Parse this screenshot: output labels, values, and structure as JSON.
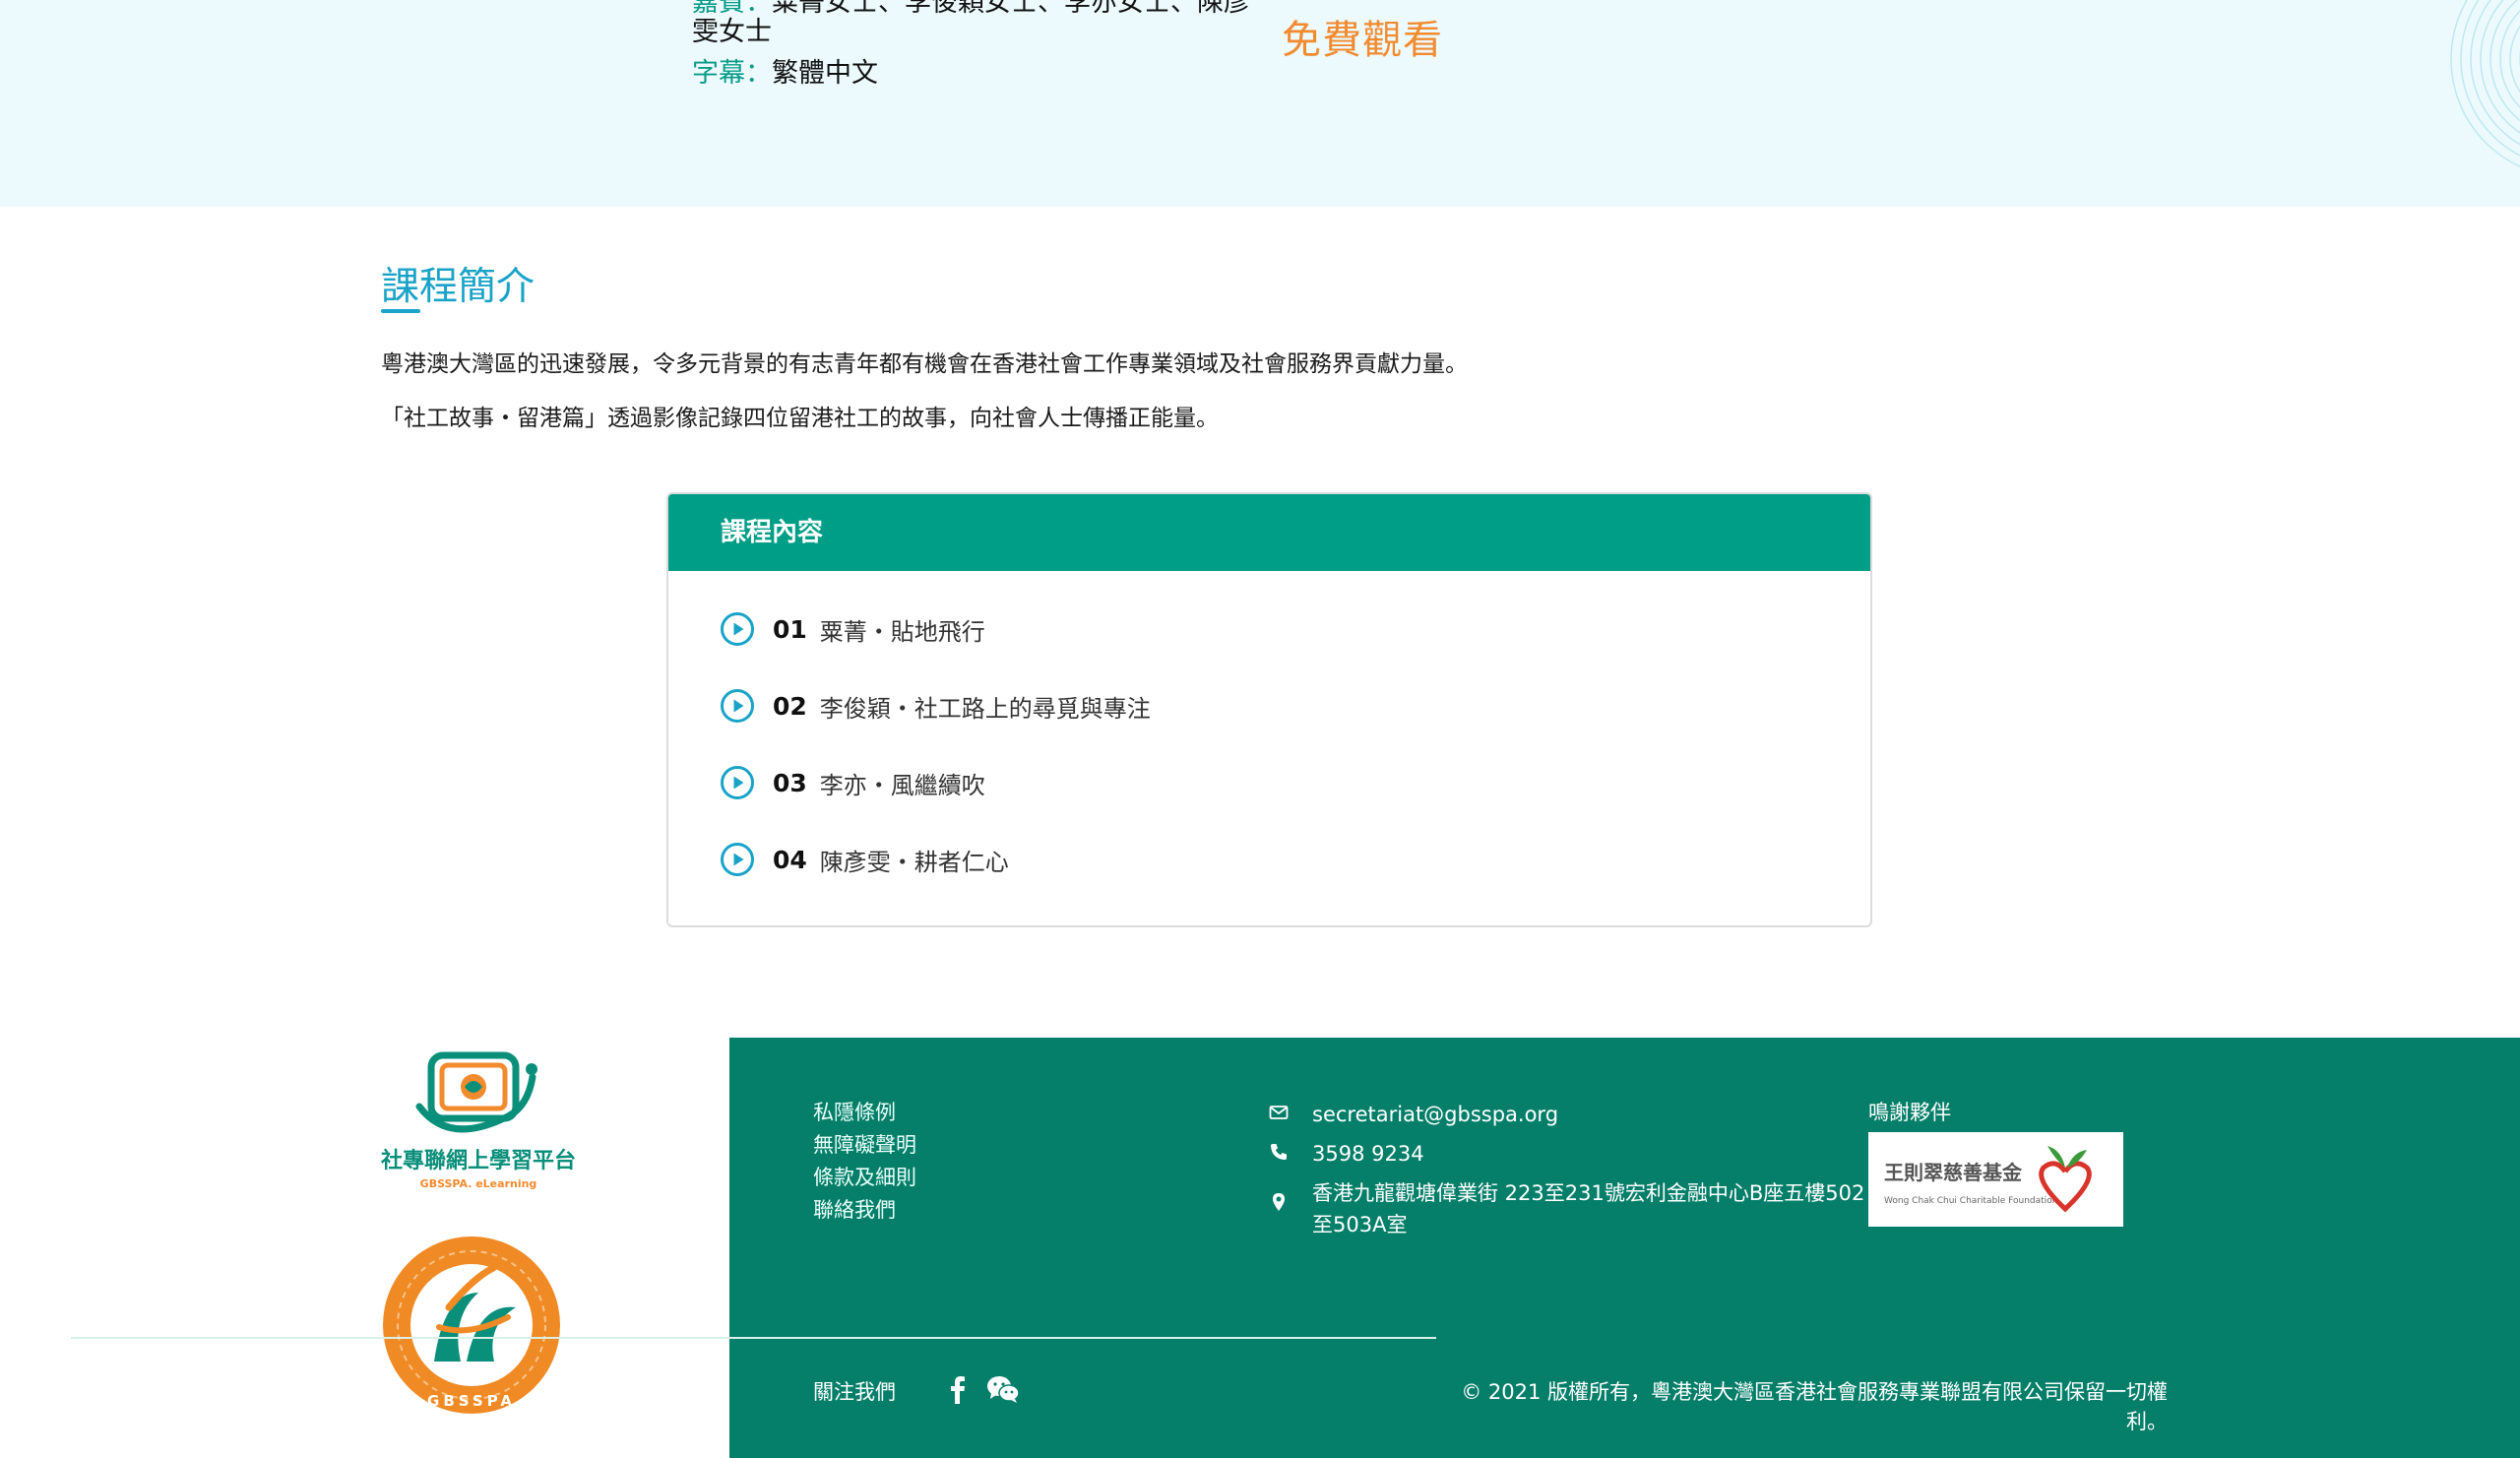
{
  "header_info": {
    "guests_label": "嘉賓：",
    "guests_line1": "粟菁女士、李俊穎女士、李亦女士、陳彥",
    "guests_line2": "雯女士",
    "subtitles_label": "字幕：",
    "subtitles_value": "繁體中文",
    "free_watch": "免費觀看"
  },
  "intro": {
    "title": "課程簡介",
    "line1": "粵港澳大灣區的迅速發展，令多元背景的有志青年都有機會在香港社會工作專業領域及社會服務界貢獻力量。",
    "line2": "「社工故事・留港篇」透過影像記錄四位留港社工的故事，向社會人士傳播正能量。"
  },
  "course": {
    "heading": "課程內容",
    "lessons": [
      {
        "num": "01",
        "title": "粟菁・貼地飛行"
      },
      {
        "num": "02",
        "title": "李俊穎・社工路上的尋覓與專注"
      },
      {
        "num": "03",
        "title": "李亦・風繼續吹"
      },
      {
        "num": "04",
        "title": "陳彥雯・耕者仁心"
      }
    ]
  },
  "footer": {
    "logo_text": "社專聯網上學習平台",
    "logo_subtext": "GBSSPA. eLearning",
    "badge_text": "GBSSPA",
    "links": [
      "私隱條例",
      "無障礙聲明",
      "條款及細則",
      "聯絡我們"
    ],
    "email": "secretariat@gbsspa.org",
    "phone": "3598 9234",
    "address_line1": "香港九龍觀塘偉業街 223至231號宏利金融中心B座五樓502",
    "address_line2": "至503A室",
    "thanks_label": "鳴謝夥伴",
    "sponsor_name_zh": "王則翠慈善基金",
    "sponsor_name_en": "Wong Chak Chui Charitable Foundation",
    "follow_label": "關注我們",
    "copyright": "© 2021 版權所有，粵港澳大灣區香港社會服務專業聯盟有限公司保留一切權利。"
  },
  "colors": {
    "teal": "#009e86",
    "footer_green": "#067f6a",
    "accent_blue": "#1aa3c8",
    "orange": "#f28a2e",
    "top_band": "#ecfafd"
  }
}
